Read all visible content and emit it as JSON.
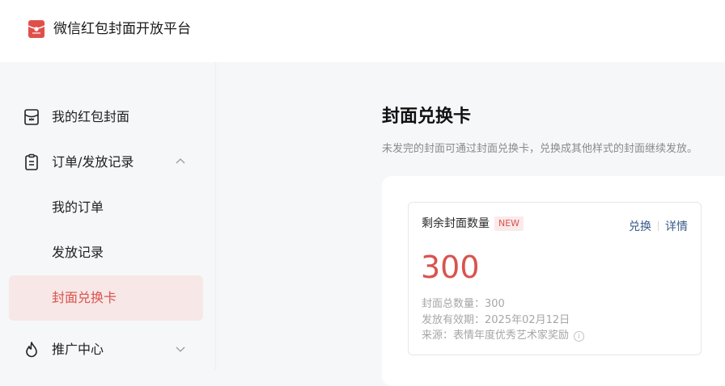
{
  "app": {
    "title": "微信红包封面开放平台",
    "logo_icon": "red-envelope-logo-icon"
  },
  "sidebar": {
    "items": [
      {
        "label": "我的红包封面",
        "icon": "envelope-icon"
      },
      {
        "label": "订单/发放记录",
        "icon": "clipboard-icon",
        "expanded": true
      },
      {
        "label": "我的订单"
      },
      {
        "label": "发放记录"
      },
      {
        "label": "封面兑换卡",
        "active": true
      },
      {
        "label": "推广中心",
        "icon": "flame-icon",
        "expanded": false
      }
    ]
  },
  "main": {
    "title": "封面兑换卡",
    "subtitle": "未发完的封面可通过封面兑换卡，兑换成其他样式的封面继续发放。"
  },
  "card": {
    "label": "剩余封面数量",
    "badge": "NEW",
    "action_exchange": "兑换",
    "action_details": "详情",
    "remaining": "300",
    "total_line": "封面总数量：300",
    "validity_line": "发放有效期：2025年02月12日",
    "source_line": "来源：表情年度优秀艺术家奖励"
  },
  "colors": {
    "accent": "#d9534f",
    "active_bg": "#f7e7e6",
    "link": "#3c5a8a"
  }
}
